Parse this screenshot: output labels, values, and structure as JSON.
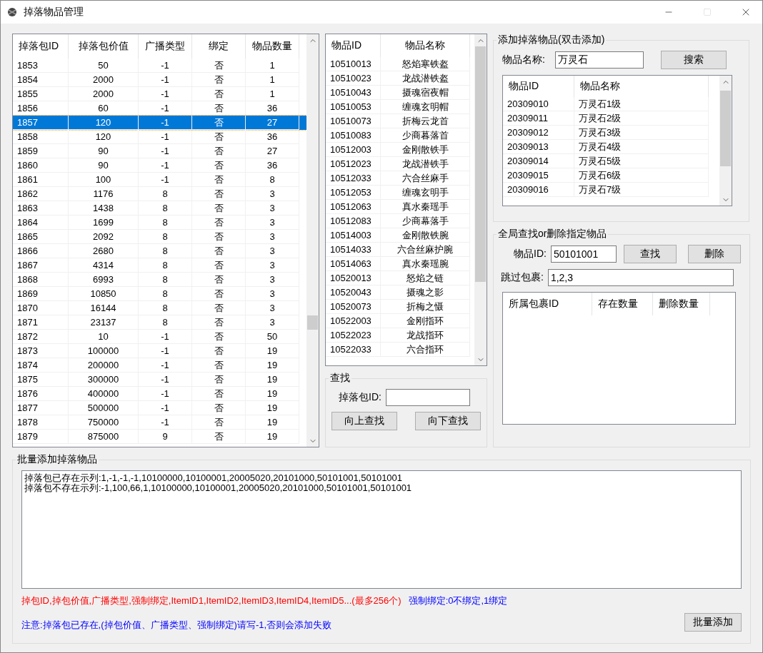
{
  "window": {
    "title": "掉落物品管理"
  },
  "drop_table": {
    "columns": [
      "掉落包ID",
      "掉落包价值",
      "广播类型",
      "绑定",
      "物品数量"
    ],
    "rows": [
      {
        "cells": [
          "1853",
          "50",
          "-1",
          "否",
          "1"
        ],
        "selected": false
      },
      {
        "cells": [
          "1854",
          "2000",
          "-1",
          "否",
          "1"
        ],
        "selected": false
      },
      {
        "cells": [
          "1855",
          "2000",
          "-1",
          "否",
          "1"
        ],
        "selected": false
      },
      {
        "cells": [
          "1856",
          "60",
          "-1",
          "否",
          "36"
        ],
        "selected": false
      },
      {
        "cells": [
          "1857",
          "120",
          "-1",
          "否",
          "27"
        ],
        "selected": true
      },
      {
        "cells": [
          "1858",
          "120",
          "-1",
          "否",
          "36"
        ],
        "selected": false
      },
      {
        "cells": [
          "1859",
          "90",
          "-1",
          "否",
          "27"
        ],
        "selected": false
      },
      {
        "cells": [
          "1860",
          "90",
          "-1",
          "否",
          "36"
        ],
        "selected": false
      },
      {
        "cells": [
          "1861",
          "100",
          "-1",
          "否",
          "8"
        ],
        "selected": false
      },
      {
        "cells": [
          "1862",
          "1176",
          "8",
          "否",
          "3"
        ],
        "selected": false
      },
      {
        "cells": [
          "1863",
          "1438",
          "8",
          "否",
          "3"
        ],
        "selected": false
      },
      {
        "cells": [
          "1864",
          "1699",
          "8",
          "否",
          "3"
        ],
        "selected": false
      },
      {
        "cells": [
          "1865",
          "2092",
          "8",
          "否",
          "3"
        ],
        "selected": false
      },
      {
        "cells": [
          "1866",
          "2680",
          "8",
          "否",
          "3"
        ],
        "selected": false
      },
      {
        "cells": [
          "1867",
          "4314",
          "8",
          "否",
          "3"
        ],
        "selected": false
      },
      {
        "cells": [
          "1868",
          "6993",
          "8",
          "否",
          "3"
        ],
        "selected": false
      },
      {
        "cells": [
          "1869",
          "10850",
          "8",
          "否",
          "3"
        ],
        "selected": false
      },
      {
        "cells": [
          "1870",
          "16144",
          "8",
          "否",
          "3"
        ],
        "selected": false
      },
      {
        "cells": [
          "1871",
          "23137",
          "8",
          "否",
          "3"
        ],
        "selected": false
      },
      {
        "cells": [
          "1872",
          "10",
          "-1",
          "否",
          "50"
        ],
        "selected": false
      },
      {
        "cells": [
          "1873",
          "100000",
          "-1",
          "否",
          "19"
        ],
        "selected": false
      },
      {
        "cells": [
          "1874",
          "200000",
          "-1",
          "否",
          "19"
        ],
        "selected": false
      },
      {
        "cells": [
          "1875",
          "300000",
          "-1",
          "否",
          "19"
        ],
        "selected": false
      },
      {
        "cells": [
          "1876",
          "400000",
          "-1",
          "否",
          "19"
        ],
        "selected": false
      },
      {
        "cells": [
          "1877",
          "500000",
          "-1",
          "否",
          "19"
        ],
        "selected": false
      },
      {
        "cells": [
          "1878",
          "750000",
          "-1",
          "否",
          "19"
        ],
        "selected": false
      },
      {
        "cells": [
          "1879",
          "875000",
          "9",
          "否",
          "19"
        ],
        "selected": false
      }
    ]
  },
  "item_table": {
    "columns": [
      "物品ID",
      "物品名称"
    ],
    "rows": [
      [
        "10510013",
        "怒焰寒铁盔"
      ],
      [
        "10510023",
        "龙战潜铁盔"
      ],
      [
        "10510043",
        "摄魂宿夜帽"
      ],
      [
        "10510053",
        "缠魂玄明帽"
      ],
      [
        "10510073",
        "折梅云龙首"
      ],
      [
        "10510083",
        "少商暮落首"
      ],
      [
        "10512003",
        "金刚散铁手"
      ],
      [
        "10512023",
        "龙战潜铁手"
      ],
      [
        "10512033",
        "六合丝麻手"
      ],
      [
        "10512053",
        "缠魂玄明手"
      ],
      [
        "10512063",
        "真水秦瑶手"
      ],
      [
        "10512083",
        "少商幕落手"
      ],
      [
        "10514003",
        "金刚散铁腕"
      ],
      [
        "10514033",
        "六合丝麻护腕"
      ],
      [
        "10514063",
        "真水秦瑶腕"
      ],
      [
        "10520013",
        "怒焰之链"
      ],
      [
        "10520043",
        "摄魂之影"
      ],
      [
        "10520073",
        "折梅之慑"
      ],
      [
        "10522003",
        "金刚指环"
      ],
      [
        "10522023",
        "龙战指环"
      ],
      [
        "10522033",
        "六合指环"
      ]
    ]
  },
  "search_group": {
    "title": "查找",
    "label": "掉落包ID:",
    "buttons": [
      "向上查找",
      "向下查找"
    ]
  },
  "add_group": {
    "title": "添加掉落物品(双击添加)",
    "label": "物品名称:",
    "value": "万灵石",
    "button": "搜索",
    "table": {
      "columns": [
        "物品ID",
        "物品名称"
      ],
      "rows": [
        [
          "20309010",
          "万灵石1级"
        ],
        [
          "20309011",
          "万灵石2级"
        ],
        [
          "20309012",
          "万灵石3级"
        ],
        [
          "20309013",
          "万灵石4级"
        ],
        [
          "20309014",
          "万灵石5级"
        ],
        [
          "20309015",
          "万灵石6级"
        ],
        [
          "20309016",
          "万灵石7级"
        ]
      ]
    }
  },
  "global_group": {
    "title": "全局查找or删除指定物品",
    "id_label": "物品ID:",
    "id_value": "50101001",
    "buttons": [
      "查找",
      "删除"
    ],
    "skip_label": "跳过包裹:",
    "skip_value": "1,2,3",
    "table": {
      "columns": [
        "所属包裹ID",
        "存在数量",
        "删除数量"
      ]
    }
  },
  "batch_group": {
    "title": "批量添加掉落物品",
    "text": "掉落包已存在示列:1,-1,-1,-1,10100000,10100001,20005020,20101000,50101001,50101001\n掉落包不存在示列:-1,100,66,1,10100000,10100001,20005020,20101000,50101001,50101001",
    "notes": [
      [
        {
          "text": "掉包ID,掉包价值,广播类型,强制绑定,ItemID1,ItemID2,ItemID3,ItemID4,ItemID5...(最多256个)",
          "color": "#ff0000"
        },
        {
          "text": "强制绑定:0不绑定,1绑定",
          "color": "#0000ff"
        }
      ],
      [
        {
          "text": "注意:掉落包已存在,(掉包价值、广播类型、强制绑定)请写-1,否则会添加失败",
          "color": "#0000ff"
        }
      ]
    ],
    "button": "批量添加"
  }
}
